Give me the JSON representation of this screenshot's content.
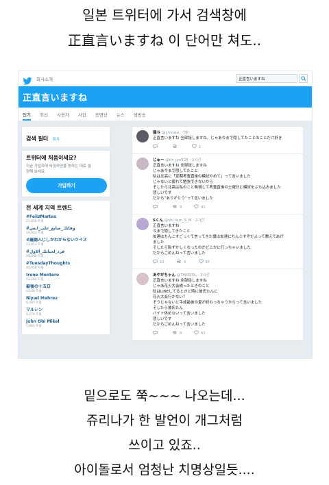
{
  "caption_top": [
    "일본 트위터에 가서 검색창에",
    "正直言いますね 이 단어만 쳐도.."
  ],
  "caption_bottom": [
    "밑으로도 쭉~~~ 나오는데...",
    "쥬리나가 한 발언이 개그처럼",
    "쓰이고 있죠..",
    "아이돌로서 엄청난 치명상일듯...."
  ],
  "nav": {
    "home": "회사소개",
    "search_value": "正直言いますね"
  },
  "banner_title": "正直言いますね",
  "tabs": [
    "인기",
    "최신",
    "사용자",
    "사진",
    "동영상",
    "뉴스",
    "생방송"
  ],
  "sidebar": {
    "filter_title": "검색 필터",
    "filter_show": "· 표시",
    "new_title": "트위터에 처음이세요?",
    "new_desc": [
      "지금 가입하여 타임라인을 원하는 대로 설",
      "정해 보세요."
    ],
    "signup_label": "가입하기",
    "trends_title": "전 세계 지역 트렌드",
    "trends": [
      {
        "name": "#FelizMartes",
        "count": "21,626 트윗"
      },
      {
        "name": "#وفاتك_ضايع_على_ايش",
        "count": "16,922 트윗"
      },
      {
        "name": "#羅闘人じしかわからないクイズ",
        "count": "13,053 트윗"
      },
      {
        "name": "#فرد_لحياتك_الاول",
        "count": "68,065 트윗"
      },
      {
        "name": "#TuesdayThoughts",
        "count": "40,958 트윗"
      },
      {
        "name": "Irene Montero",
        "count": "13,264 트윗"
      },
      {
        "name": "最後の十五日",
        "count": "6,108 트윗"
      },
      {
        "name": "Riyad Mahrez",
        "count": "6,707 트윗"
      },
      {
        "name": "マルシン",
        "count": "6,279 트윗"
      },
      {
        "name": "John Obi Mikel",
        "count": "5,665 트윗"
      }
    ]
  },
  "tweets": [
    {
      "name": "翡斗",
      "handle": "@ymowa · 7분",
      "lines": [
        "正直言いますね 全部話しますね、じゃあ今まで隠してたことのことだけ好き"
      ],
      "replies": "",
      "retweets": "",
      "likes": "1",
      "avatar_color": "#5b5b66"
    },
    {
      "name": "じゅー",
      "handle": "@ttt_jyo526 · 2시간",
      "lines": [
        "正直言いますね 全部話しますね",
        "じゃあ今まで隠してたこと",
        "私は北高に「定期考査直後の模試やめて」って言いました",
        "じゃないと疲れて勉強できないから",
        "そしたら北高は私のこと無視して考査直後の土曜日に模試をぶち込みました",
        "悲しいです",
        "だから“ありがとう”って言いました"
      ],
      "replies": "",
      "retweets": "9",
      "likes": "91",
      "avatar_color": "#c9b7c4"
    },
    {
      "name": "Sくん",
      "handle": "@shi_kun_S_M · 2시간",
      "lines": [
        "正直言いますね",
        "今まで隠してきたこと",
        "友達はちんこすごっくて言ってきた僕は友達にちんこすぞだよって教えてあげ",
        "ました",
        "そしたら恥ずかしくなったのかどこかに行っちゃいました",
        "だからごめんねって言いました"
      ],
      "replies": "13",
      "retweets": "5",
      "likes": "87",
      "avatar_color": "#b7a9d6"
    },
    {
      "name": "あやかちゃん",
      "handle": "@TWIIDOL · 3시간",
      "lines": [
        "正直言いますね 全部話しますね",
        "じゃあ花火大会誘ったときのこと",
        "私はLINEしてるときに時に彼氏たんに",
        "花火大会行かない？",
        "そうじゃないと平成最後の夏が終わっちゃうからって言いました",
        "そしたら彼氏たん",
        "バイト休めないって言いました",
        "悲しいです",
        "だからごめんねって言いました"
      ],
      "replies": "",
      "retweets": "8",
      "likes": "63",
      "avatar_color": "#d8c3c9"
    }
  ]
}
